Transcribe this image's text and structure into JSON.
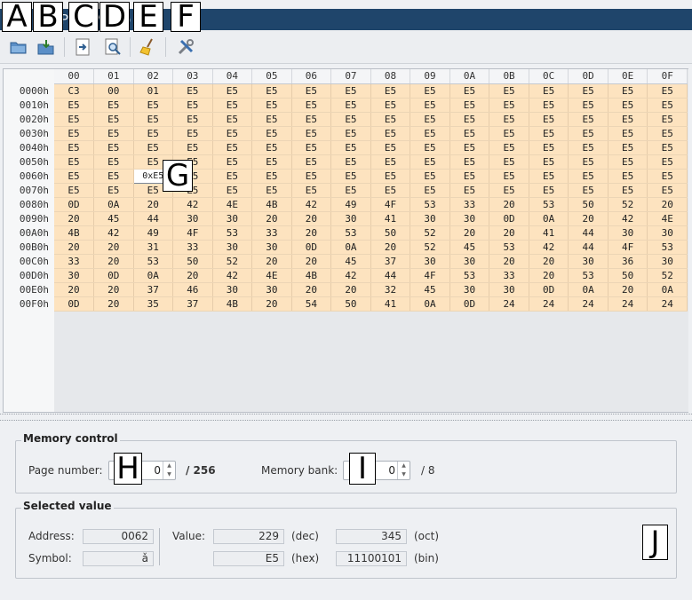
{
  "window": {
    "title": "Show CP/M Memory"
  },
  "markers": {
    "a": "A",
    "b": "B",
    "c": "C",
    "d": "D",
    "e": "E",
    "f": "F",
    "g": "G",
    "h": "H",
    "i": "I",
    "j": "J"
  },
  "toolbar": {
    "buttons": [
      {
        "icon": "open-folder-icon"
      },
      {
        "icon": "save-icon"
      },
      {
        "icon": "load-icon"
      },
      {
        "icon": "find-icon"
      },
      {
        "icon": "clear-broom-icon"
      },
      {
        "icon": "settings-tools-icon"
      }
    ]
  },
  "grid": {
    "columns": [
      "00",
      "01",
      "02",
      "03",
      "04",
      "05",
      "06",
      "07",
      "08",
      "09",
      "0A",
      "0B",
      "0C",
      "0D",
      "0E",
      "0F"
    ],
    "rows": [
      {
        "addr": "0000h",
        "cells": [
          "C3",
          "00",
          "01",
          "E5",
          "E5",
          "E5",
          "E5",
          "E5",
          "E5",
          "E5",
          "E5",
          "E5",
          "E5",
          "E5",
          "E5",
          "E5"
        ]
      },
      {
        "addr": "0010h",
        "cells": [
          "E5",
          "E5",
          "E5",
          "E5",
          "E5",
          "E5",
          "E5",
          "E5",
          "E5",
          "E5",
          "E5",
          "E5",
          "E5",
          "E5",
          "E5",
          "E5"
        ]
      },
      {
        "addr": "0020h",
        "cells": [
          "E5",
          "E5",
          "E5",
          "E5",
          "E5",
          "E5",
          "E5",
          "E5",
          "E5",
          "E5",
          "E5",
          "E5",
          "E5",
          "E5",
          "E5",
          "E5"
        ]
      },
      {
        "addr": "0030h",
        "cells": [
          "E5",
          "E5",
          "E5",
          "E5",
          "E5",
          "E5",
          "E5",
          "E5",
          "E5",
          "E5",
          "E5",
          "E5",
          "E5",
          "E5",
          "E5",
          "E5"
        ]
      },
      {
        "addr": "0040h",
        "cells": [
          "E5",
          "E5",
          "E5",
          "E5",
          "E5",
          "E5",
          "E5",
          "E5",
          "E5",
          "E5",
          "E5",
          "E5",
          "E5",
          "E5",
          "E5",
          "E5"
        ]
      },
      {
        "addr": "0050h",
        "cells": [
          "E5",
          "E5",
          "E5",
          "E5",
          "E5",
          "E5",
          "E5",
          "E5",
          "E5",
          "E5",
          "E5",
          "E5",
          "E5",
          "E5",
          "E5",
          "E5"
        ]
      },
      {
        "addr": "0060h",
        "cells": [
          "E5",
          "E5",
          "0xE5",
          "E5",
          "E5",
          "E5",
          "E5",
          "E5",
          "E5",
          "E5",
          "E5",
          "E5",
          "E5",
          "E5",
          "E5",
          "E5"
        ]
      },
      {
        "addr": "0070h",
        "cells": [
          "E5",
          "E5",
          "E5",
          "E5",
          "E5",
          "E5",
          "E5",
          "E5",
          "E5",
          "E5",
          "E5",
          "E5",
          "E5",
          "E5",
          "E5",
          "E5"
        ]
      },
      {
        "addr": "0080h",
        "cells": [
          "0D",
          "0A",
          "20",
          "42",
          "4E",
          "4B",
          "42",
          "49",
          "4F",
          "53",
          "33",
          "20",
          "53",
          "50",
          "52",
          "20"
        ]
      },
      {
        "addr": "0090h",
        "cells": [
          "20",
          "45",
          "44",
          "30",
          "30",
          "20",
          "20",
          "30",
          "41",
          "30",
          "30",
          "0D",
          "0A",
          "20",
          "42",
          "4E"
        ]
      },
      {
        "addr": "00A0h",
        "cells": [
          "4B",
          "42",
          "49",
          "4F",
          "53",
          "33",
          "20",
          "53",
          "50",
          "52",
          "20",
          "20",
          "41",
          "44",
          "30",
          "30"
        ]
      },
      {
        "addr": "00B0h",
        "cells": [
          "20",
          "20",
          "31",
          "33",
          "30",
          "30",
          "0D",
          "0A",
          "20",
          "52",
          "45",
          "53",
          "42",
          "44",
          "4F",
          "53"
        ]
      },
      {
        "addr": "00C0h",
        "cells": [
          "33",
          "20",
          "53",
          "50",
          "52",
          "20",
          "20",
          "45",
          "37",
          "30",
          "30",
          "20",
          "20",
          "30",
          "36",
          "30"
        ]
      },
      {
        "addr": "00D0h",
        "cells": [
          "30",
          "0D",
          "0A",
          "20",
          "42",
          "4E",
          "4B",
          "42",
          "44",
          "4F",
          "53",
          "33",
          "20",
          "53",
          "50",
          "52"
        ]
      },
      {
        "addr": "00E0h",
        "cells": [
          "20",
          "20",
          "37",
          "46",
          "30",
          "30",
          "20",
          "20",
          "32",
          "45",
          "30",
          "30",
          "0D",
          "0A",
          "20",
          "0A"
        ]
      },
      {
        "addr": "00F0h",
        "cells": [
          "0D",
          "20",
          "35",
          "37",
          "4B",
          "20",
          "54",
          "50",
          "41",
          "0A",
          "0D",
          "24",
          "24",
          "24",
          "24",
          "24"
        ]
      }
    ]
  },
  "memory_control": {
    "title": "Memory control",
    "page_label": "Page number:",
    "page_value": "0",
    "page_total": "/ 256",
    "bank_label": "Memory bank:",
    "bank_value": "0",
    "bank_total": "/ 8"
  },
  "selected_value": {
    "title": "Selected value",
    "address_label": "Address:",
    "address": "0062",
    "symbol_label": "Symbol:",
    "symbol": "ǎ",
    "value_label": "Value:",
    "dec": "229",
    "dec_label": "(dec)",
    "oct": "345",
    "oct_label": "(oct)",
    "hex": "E5",
    "hex_label": "(hex)",
    "bin": "11100101",
    "bin_label": "(bin)"
  }
}
